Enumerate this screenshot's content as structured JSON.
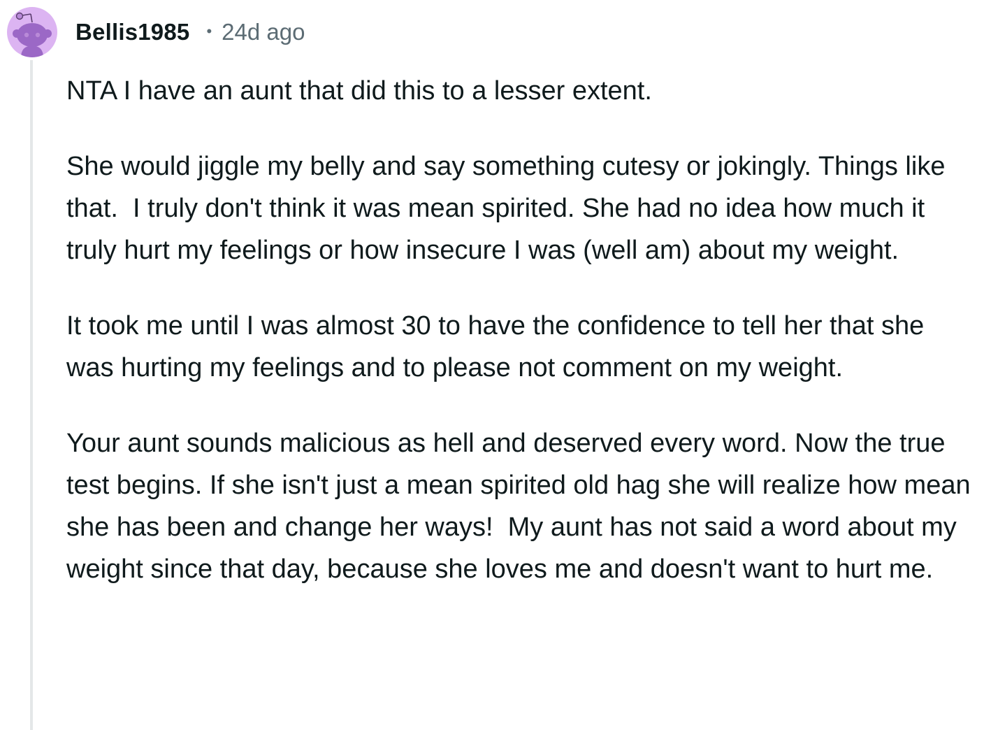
{
  "comment": {
    "username": "Bellis1985",
    "separator": "•",
    "timestamp": "24d ago",
    "avatar_icon": "snoo-avatar-icon",
    "colors": {
      "avatar_bg": "#dcb4f2",
      "avatar_figure": "#9b68c6",
      "thread_line": "#e4e7e8",
      "meta_text": "#5c6c74"
    },
    "paragraphs": [
      "NTA I have an aunt that did this to a lesser extent.",
      "She would jiggle my belly and say something cutesy or jokingly. Things like that.  I truly don't think it was mean spirited. She had no idea how much it truly hurt my feelings or how insecure I was (well am) about my weight.",
      "It took me until I was almost 30 to have the confidence to tell her that she was hurting my feelings and to please not comment on my weight.",
      "Your aunt sounds malicious as hell and deserved every word. Now the true test begins. If she isn't just a mean spirited old hag she will realize how mean she has been and change her ways!  My aunt has not said a word about my weight since that day, because she loves me and doesn't want to hurt me."
    ]
  }
}
